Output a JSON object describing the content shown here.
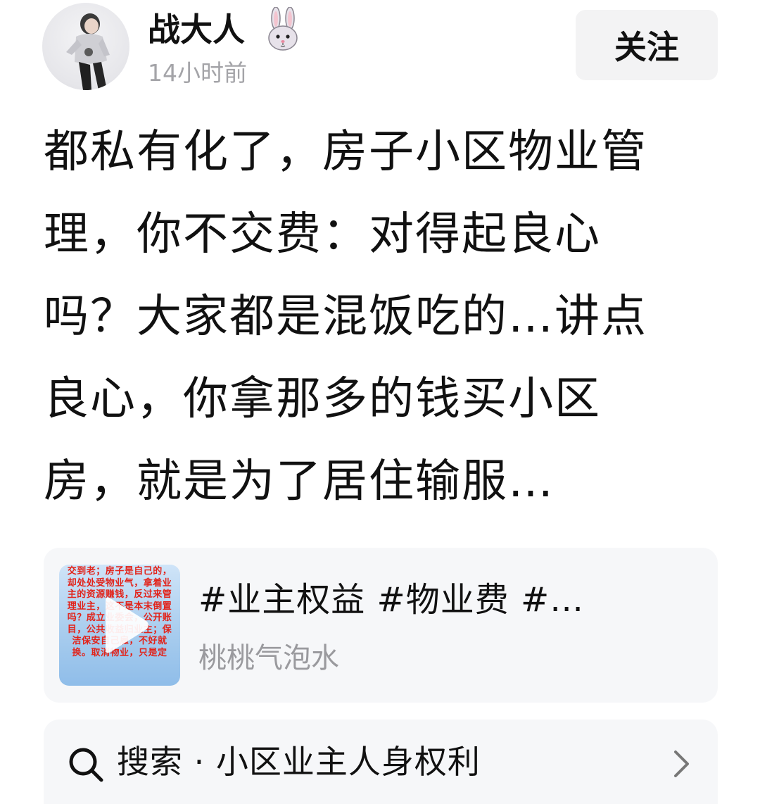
{
  "author": {
    "name": "战大人",
    "badge": "rabbit-emoji",
    "time": "14小时前"
  },
  "follow_button": {
    "label": "关注"
  },
  "post": {
    "lines": [
      "都私有化了，房子小区物业管",
      "理，你不交费：对得起良心",
      "吗？大家都是混饭吃的…讲点",
      "良心，你拿那多的钱买小区",
      "房，就是为了居住输服…"
    ]
  },
  "linked_video": {
    "title": "#业主权益 #物业费 #…",
    "author": "桃桃气泡水",
    "thumbnail_text": "交到老；房子是自己的，却处处受物业气，拿着业主的资源赚钱，反过来管理业主，这不是本末倒置吗？成立业委会，公开账目，公共收益归业主；保洁保安自己雇，不好就换。取消物业，只是定"
  },
  "search": {
    "prefix": "搜索",
    "separator": " · ",
    "query": "小区业主人身权利"
  },
  "colors": {
    "text": "#111111",
    "muted": "#a4a4a8",
    "card_bg": "#f6f7f9",
    "button_bg": "#f3f3f4",
    "thumb_text": "#e2231a"
  }
}
